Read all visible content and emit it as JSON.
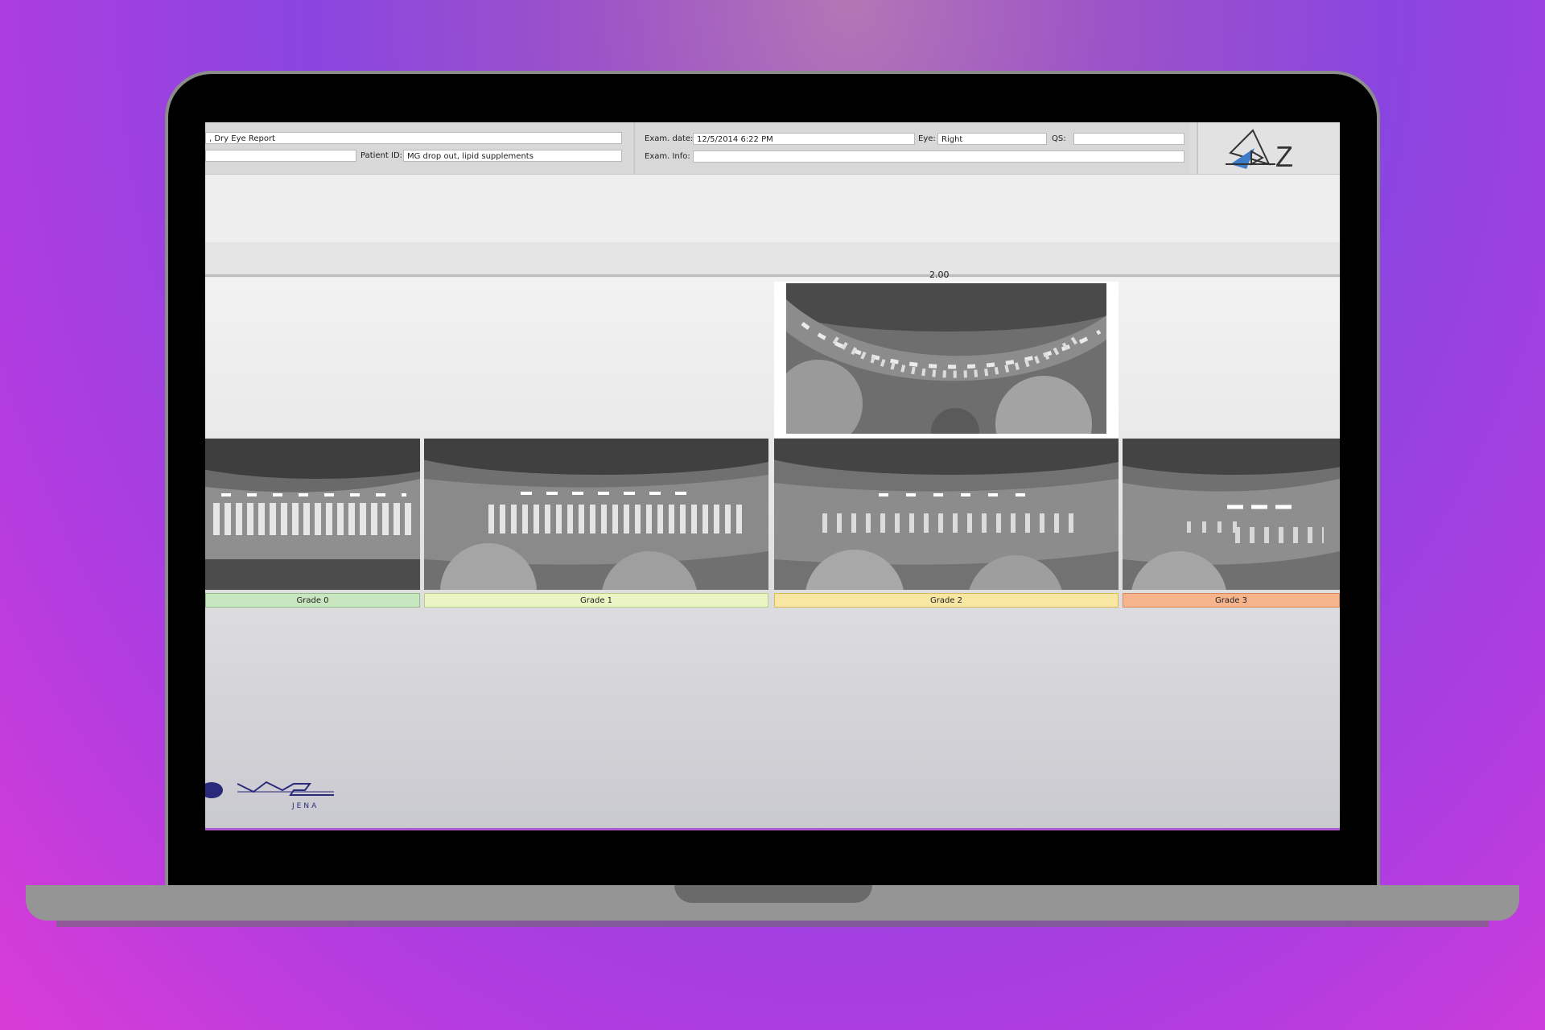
{
  "header": {
    "report_title": ", Dry Eye Report",
    "name_value": "",
    "patient_id_label": "Patient ID:",
    "patient_id_value": "MG drop out, lipid supplements",
    "exam_date_label": "Exam. date:",
    "exam_date_value": "12/5/2014 6:22 PM",
    "eye_label": "Eye:",
    "eye_value": "Right",
    "qs_label": "QS:",
    "qs_value": "",
    "exam_info_label": "Exam. Info:",
    "exam_info_value": "",
    "logo_text": "Z OC"
  },
  "selection": {
    "value": "2.00"
  },
  "grades": [
    {
      "label": "Grade 0",
      "color": "#c8e6c0"
    },
    {
      "label": "Grade 1",
      "color": "#eaf5c4"
    },
    {
      "label": "Grade 2",
      "color": "#f8e7a2"
    },
    {
      "label": "Grade 3",
      "color": "#f6b48c"
    }
  ],
  "brand": {
    "vis_logo_text": "VIS",
    "vis_logo_subtext": "JENA"
  },
  "colors": {
    "background_left": "#7a3fe6",
    "background_right": "#e03cd4",
    "zeiss_blue": "#3d7cc9"
  }
}
